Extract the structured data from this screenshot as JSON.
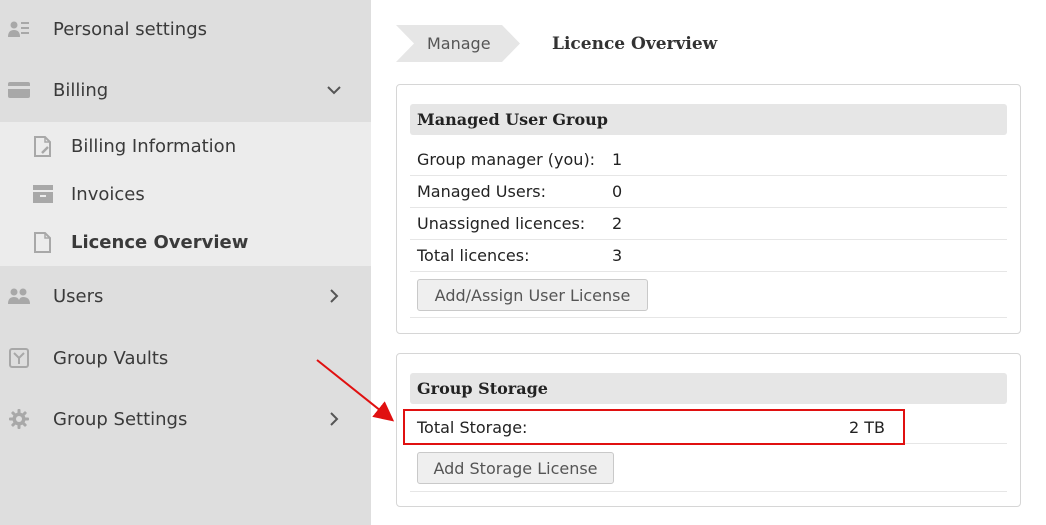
{
  "sidebar": {
    "items": [
      {
        "label": "Personal settings",
        "icon": "user-settings-icon"
      },
      {
        "label": "Billing",
        "icon": "card-icon",
        "expanded": true
      },
      {
        "label": "Users",
        "icon": "users-icon"
      },
      {
        "label": "Group Vaults",
        "icon": "vault-icon"
      },
      {
        "label": "Group Settings",
        "icon": "gear-icon"
      }
    ],
    "billing_sub": [
      {
        "label": "Billing Information",
        "icon": "document-edit-icon"
      },
      {
        "label": "Invoices",
        "icon": "invoice-icon"
      },
      {
        "label": "Licence Overview",
        "icon": "document-icon",
        "active": true
      }
    ]
  },
  "breadcrumb": {
    "parent": "Manage",
    "current": "Licence Overview"
  },
  "managed_group": {
    "title": "Managed User Group",
    "rows": [
      {
        "label": "Group manager (you):",
        "value": "1"
      },
      {
        "label": "Managed Users:",
        "value": "0"
      },
      {
        "label": "Unassigned licences:",
        "value": "2"
      },
      {
        "label": "Total licences:",
        "value": "3"
      }
    ],
    "button_label": "Add/Assign User License"
  },
  "group_storage": {
    "title": "Group Storage",
    "rows": [
      {
        "label": "Total Storage:",
        "value": "2 TB"
      }
    ],
    "button_label": "Add Storage License"
  },
  "colors": {
    "sidebar_bg": "#dedede",
    "submenu_bg": "#ececec",
    "highlight": "#e01010"
  }
}
